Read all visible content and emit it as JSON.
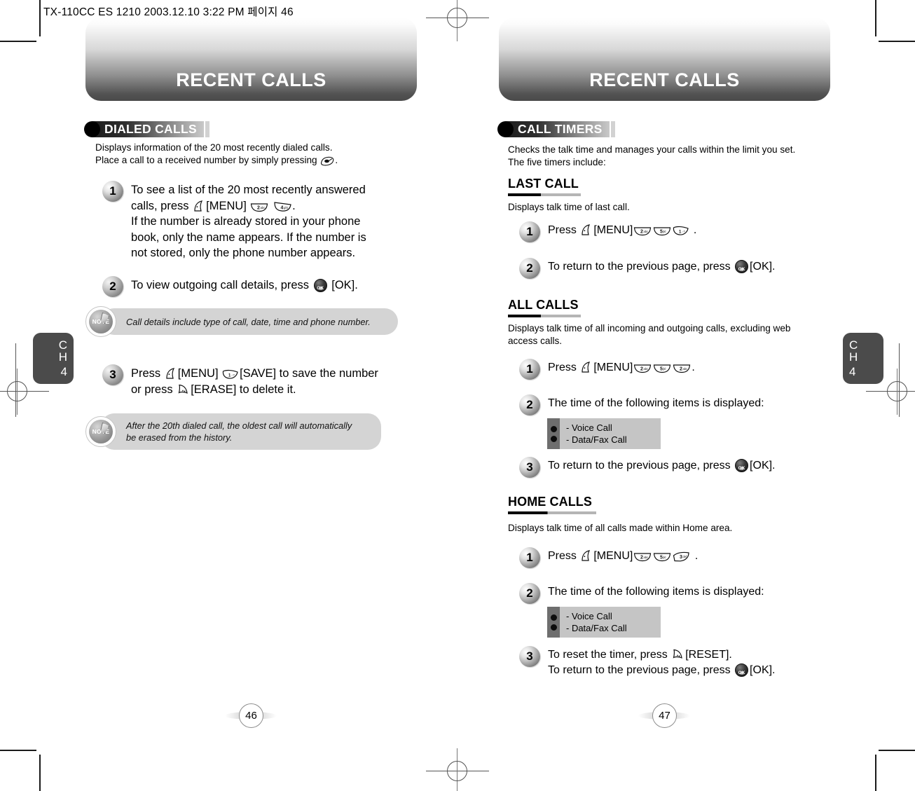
{
  "meta": {
    "slug": "TX-110CC ES 1210  2003.12.10 3:22 PM  페이지 46"
  },
  "left_page": {
    "banner_title": "RECENT CALLS",
    "section": {
      "label": "DIALED CALLS"
    },
    "lead": "Displays information of the 20 most recently dialed calls.\nPlace a call to a received number by simply pressing ⟨SEND⟩.",
    "lead_line1": "Displays information of the 20 most recently dialed calls.",
    "lead_line2a": "Place a call to a received number by simply pressing",
    "lead_line2b": ".",
    "steps": [
      {
        "num": "1",
        "line1a": "To see a list of the 20 most recently answered",
        "line2a": "calls, press",
        "line2b": "[MENU]",
        "line2c": ".",
        "line3": "If the number is already stored in your phone",
        "line4": "book, only the name appears. If the number is",
        "line5": "not stored, only the phone number appears.",
        "keys": [
          "2 abc",
          "4 ghi"
        ]
      },
      {
        "num": "2",
        "line1a": "To view outgoing call details, press",
        "line1b": "[OK]."
      },
      {
        "num": "3",
        "line1a": "Press",
        "line1b": "[MENU]",
        "line1c": "[SAVE] to save the number",
        "line2a": "or press",
        "line2b": "[ERASE] to delete it."
      }
    ],
    "notes": [
      {
        "text_line1": "Call details include type of call, date, time and phone number.",
        "text_line2": ""
      },
      {
        "text_line1": "After the 20th dialed call, the oldest call will automatically",
        "text_line2": "be erased from the history."
      }
    ],
    "chapter_tab": {
      "ch_top": "C",
      "ch_bottom": "H",
      "number": "4"
    },
    "folio": "46"
  },
  "right_page": {
    "banner_title": "RECENT CALLS",
    "section": {
      "label": "CALL TIMERS"
    },
    "lead_line1": "Checks the talk time and manages your calls within the limit you set.",
    "lead_line2": "The five timers include:",
    "subsections": [
      {
        "heading": "LAST CALL",
        "desc_line1": "Displays talk time of last call.",
        "desc_line2": "",
        "steps": [
          {
            "num": "1",
            "a": "Press",
            "b": "[MENU]",
            "c": ".",
            "keys": [
              "2 abc",
              "5 jkl",
              "1"
            ]
          },
          {
            "num": "2",
            "a": "To return to the previous page, press",
            "b": "[OK]."
          }
        ]
      },
      {
        "heading": "ALL CALLS",
        "desc_line1": "Displays talk time of all incoming and outgoing calls, excluding web",
        "desc_line2": "access calls.",
        "steps": [
          {
            "num": "1",
            "a": "Press",
            "b": "[MENU]",
            "c": ".",
            "keys": [
              "2 abc",
              "5 jkl",
              "2 abc"
            ]
          },
          {
            "num": "2",
            "a": "The time of the following items is displayed:"
          },
          {
            "num": "3",
            "a": "To return to the previous page, press",
            "b": "[OK]."
          }
        ],
        "bullets": [
          "- Voice Call",
          "- Data/Fax Call"
        ]
      },
      {
        "heading": "HOME CALLS",
        "desc_line1": "Displays talk time of all calls made within Home area.",
        "desc_line2": "",
        "steps": [
          {
            "num": "1",
            "a": "Press",
            "b": "[MENU]",
            "c": ".",
            "keys": [
              "2 abc",
              "5 jkl",
              "3 def"
            ]
          },
          {
            "num": "2",
            "a": "The time of the following items is displayed:"
          },
          {
            "num": "3",
            "a": "To reset the timer, press",
            "b": "[RESET].",
            "c": "To return to the previous page, press",
            "d": "[OK]."
          }
        ],
        "bullets": [
          "- Voice Call",
          "- Data/Fax Call"
        ]
      }
    ],
    "chapter_tab": {
      "ch_top": "C",
      "ch_bottom": "H",
      "number": "4"
    },
    "folio": "47"
  },
  "keys": {
    "menu_key": "menu-soft-key",
    "send_key": "send-key",
    "ok_key": "ok-key",
    "save_key": "save-soft-key",
    "erase_key": "erase-soft-key"
  }
}
